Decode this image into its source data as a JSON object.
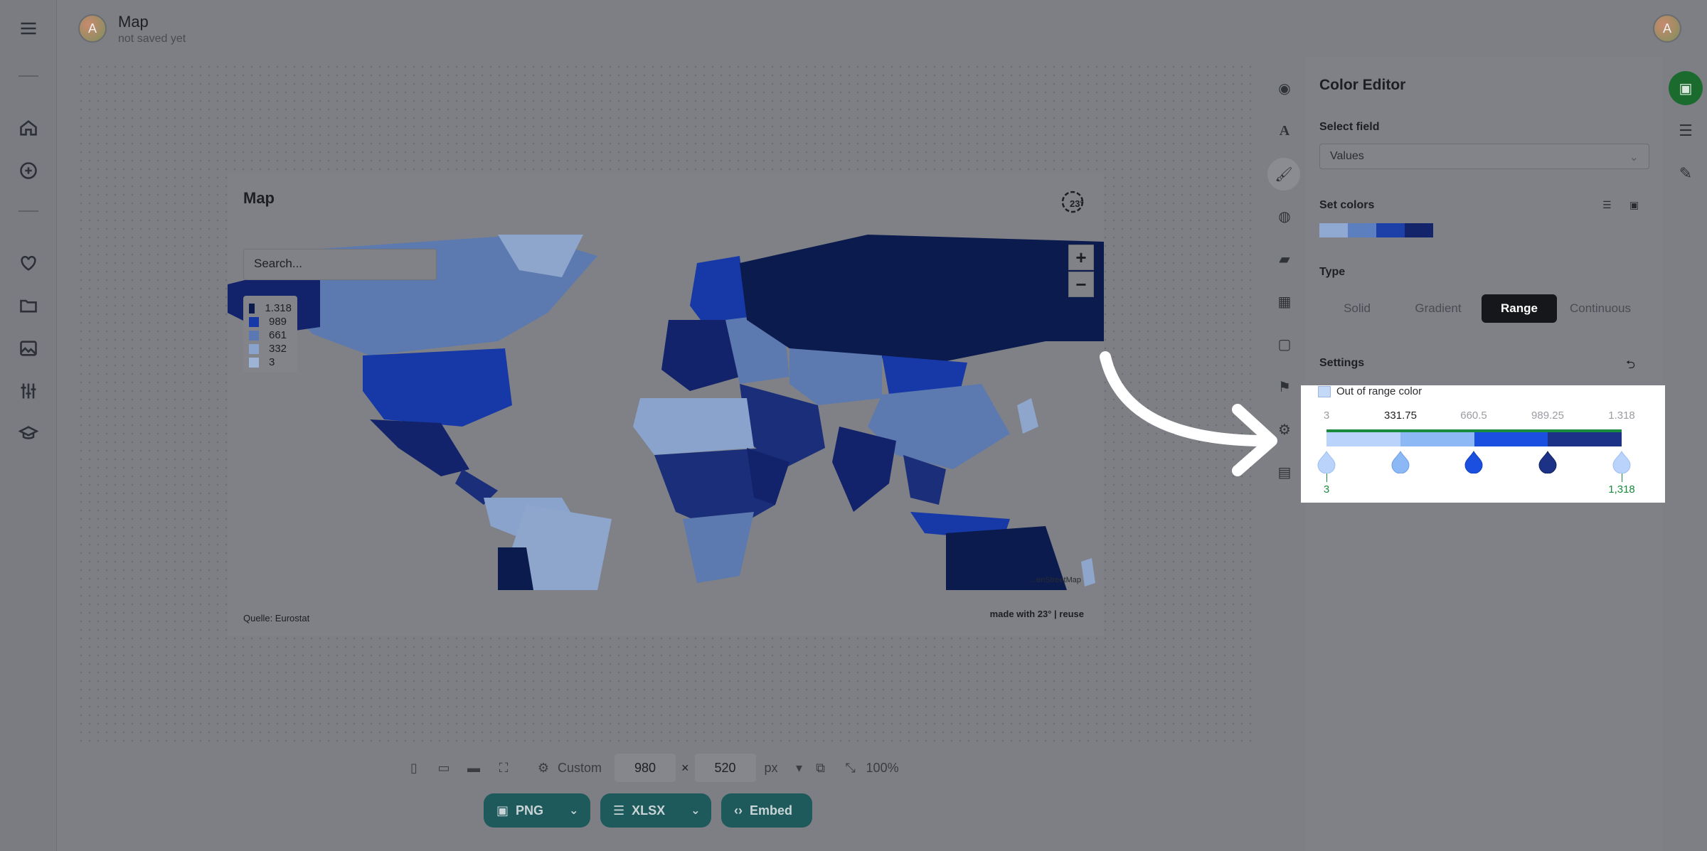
{
  "header": {
    "title": "Map",
    "subtitle": "not saved yet",
    "avatar_initial": "A"
  },
  "map_card": {
    "title": "Map",
    "logo_text": "23°",
    "search_placeholder": "Search...",
    "legend": [
      {
        "label": "1.318",
        "color": "#0b1b4d"
      },
      {
        "label": "989",
        "color": "#1739a7"
      },
      {
        "label": "661",
        "color": "#5b78b2"
      },
      {
        "label": "332",
        "color": "#8aa3cc"
      },
      {
        "label": "3",
        "color": "#9eb4d6"
      }
    ],
    "zoom_in": "+",
    "zoom_out": "−",
    "attribution": "...enStreetMap",
    "source": "Quelle: Eurostat",
    "made_with": "made with 23° | reuse"
  },
  "toolbar": {
    "custom_label": "Custom",
    "width": "980",
    "times": "×",
    "height": "520",
    "unit": "px",
    "zoom": "100%"
  },
  "export": {
    "png": "PNG",
    "xlsx": "XLSX",
    "embed": "Embed"
  },
  "panel": {
    "title": "Color Editor",
    "select_field_label": "Select field",
    "select_field_value": "Values",
    "set_colors_label": "Set colors",
    "swatches": [
      "#8fa9d3",
      "#5c7fc0",
      "#1c3fa8",
      "#14246b"
    ],
    "type_label": "Type",
    "types": [
      "Solid",
      "Gradient",
      "Range",
      "Continuous"
    ],
    "selected_type": "Range",
    "settings_label": "Settings",
    "out_of_range_label": "Out of range color",
    "ticks": [
      "3",
      "331.75",
      "660.5",
      "989.25",
      "1.318"
    ],
    "range_colors": [
      "#b9d3fb",
      "#8cb9f5",
      "#1a4fe0",
      "#1c3286"
    ],
    "handle_colors": [
      "#b9d3fb",
      "#8cb9f5",
      "#1a4fe0",
      "#1c3286",
      "#b9d3fb"
    ],
    "min_label": "3",
    "max_label": "1,318"
  }
}
